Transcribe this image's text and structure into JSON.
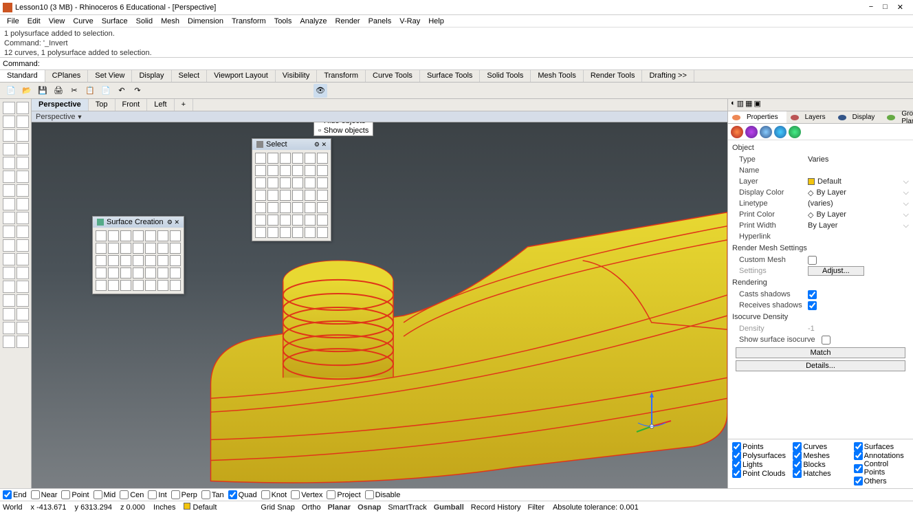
{
  "titlebar": {
    "title": "Lesson10 (3 MB) - Rhinoceros 6 Educational - [Perspective]"
  },
  "menubar": [
    "File",
    "Edit",
    "View",
    "Curve",
    "Surface",
    "Solid",
    "Mesh",
    "Dimension",
    "Transform",
    "Tools",
    "Analyze",
    "Render",
    "Panels",
    "V-Ray",
    "Help"
  ],
  "cmd_history": [
    "1 polysurface added to selection.",
    "Command: '_Invert",
    "12 curves, 1 polysurface added to selection."
  ],
  "cmd_prompt": "Command:",
  "tabbar": [
    "Standard",
    "CPlanes",
    "Set View",
    "Display",
    "Select",
    "Viewport Layout",
    "Visibility",
    "Transform",
    "Curve Tools",
    "Surface Tools",
    "Solid Tools",
    "Mesh Tools",
    "Render Tools",
    "Drafting >>"
  ],
  "tooltip": {
    "hide": "Hide objects",
    "show": "Show objects"
  },
  "view_tabs": [
    "Perspective",
    "Top",
    "Front",
    "Left",
    "+"
  ],
  "view_active": "Perspective",
  "view_title": "Perspective",
  "select_panel": {
    "title": "Select"
  },
  "surface_panel": {
    "title": "Surface Creation"
  },
  "right_tabs": [
    "Properties",
    "Layers",
    "Display",
    "Ground Plane"
  ],
  "properties": {
    "header": "Object",
    "rows": [
      {
        "label": "Type",
        "value": "Varies"
      },
      {
        "label": "Name",
        "value": ""
      },
      {
        "label": "Layer",
        "value": "Default",
        "swatch": "#f2c40e"
      },
      {
        "label": "Display Color",
        "value": "By Layer",
        "diamond": true
      },
      {
        "label": "Linetype",
        "value": "(varies)"
      },
      {
        "label": "Print Color",
        "value": "By Layer",
        "diamond": true
      },
      {
        "label": "Print Width",
        "value": "By Layer"
      },
      {
        "label": "Hyperlink",
        "value": ""
      }
    ],
    "render_mesh_hdr": "Render Mesh Settings",
    "custom_mesh": "Custom Mesh",
    "settings": "Settings",
    "adjust": "Adjust...",
    "rendering_hdr": "Rendering",
    "casts": "Casts shadows",
    "receives": "Receives shadows",
    "iso_hdr": "Isocurve Density",
    "density": "Density",
    "density_val": "-1",
    "show_iso": "Show surface isocurve",
    "match": "Match",
    "details": "Details..."
  },
  "filters": {
    "col1": [
      "Points",
      "Polysurfaces",
      "Lights",
      "Point Clouds"
    ],
    "col2": [
      "Curves",
      "Meshes",
      "Blocks",
      "Hatches"
    ],
    "col3": [
      "Surfaces",
      "Annotations",
      "Control Points",
      "Others"
    ]
  },
  "osnap": [
    "End",
    "Near",
    "Point",
    "Mid",
    "Cen",
    "Int",
    "Perp",
    "Tan",
    "Quad",
    "Knot",
    "Vertex",
    "Project",
    "Disable"
  ],
  "osnap_checked": [
    "End",
    "Quad"
  ],
  "statusbar": {
    "world": "World",
    "x": "x -413.671",
    "y": "y 6313.294",
    "z": "z 0.000",
    "units": "Inches",
    "layer": "Default",
    "toggles": [
      "Grid Snap",
      "Ortho",
      "Planar",
      "Osnap",
      "SmartTrack",
      "Gumball",
      "Record History",
      "Filter"
    ],
    "toggles_on": [
      "Planar",
      "Osnap",
      "Gumball"
    ],
    "tolerance": "Absolute tolerance: 0.001"
  }
}
